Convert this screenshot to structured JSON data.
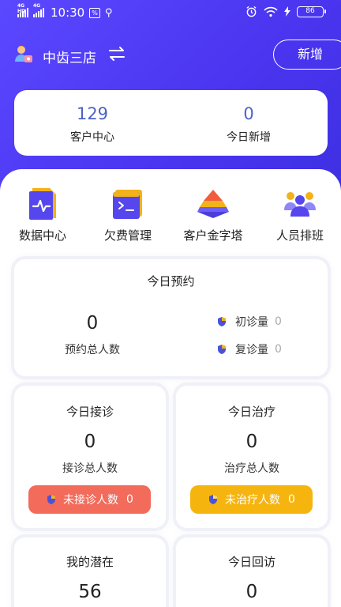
{
  "status_bar": {
    "network_1": "4G HD",
    "network_2": "4G",
    "time": "10:30",
    "badge": "%",
    "battery": "86"
  },
  "header": {
    "store_name": "中齿三店",
    "add_label": "新增"
  },
  "summary": {
    "customer_center_count": "129",
    "customer_center_label": "客户中心",
    "today_new_count": "0",
    "today_new_label": "今日新增"
  },
  "quick_menu": [
    {
      "label": "数据中心",
      "icon": "data-center-icon"
    },
    {
      "label": "欠费管理",
      "icon": "terminal-icon"
    },
    {
      "label": "客户金字塔",
      "icon": "pyramid-icon"
    },
    {
      "label": "人员排班",
      "icon": "staff-icon"
    }
  ],
  "appointments": {
    "title": "今日预约",
    "total": "0",
    "total_label": "预约总人数",
    "first_visit_label": "初诊量",
    "first_visit_value": "0",
    "return_visit_label": "复诊量",
    "return_visit_value": "0"
  },
  "reception": {
    "title": "今日接诊",
    "total": "0",
    "total_label": "接诊总人数",
    "pill_label": "未接诊人数",
    "pill_value": "0",
    "pill_color": "#f26b5b"
  },
  "treatment": {
    "title": "今日治疗",
    "total": "0",
    "total_label": "治疗总人数",
    "pill_label": "未治疗人数",
    "pill_value": "0",
    "pill_color": "#f6b40f"
  },
  "potential": {
    "title": "我的潜在",
    "total": "56"
  },
  "followup": {
    "title": "今日回访",
    "total": "0"
  },
  "colors": {
    "hero": "#4b35f0",
    "accent_number": "#4a63c8"
  }
}
